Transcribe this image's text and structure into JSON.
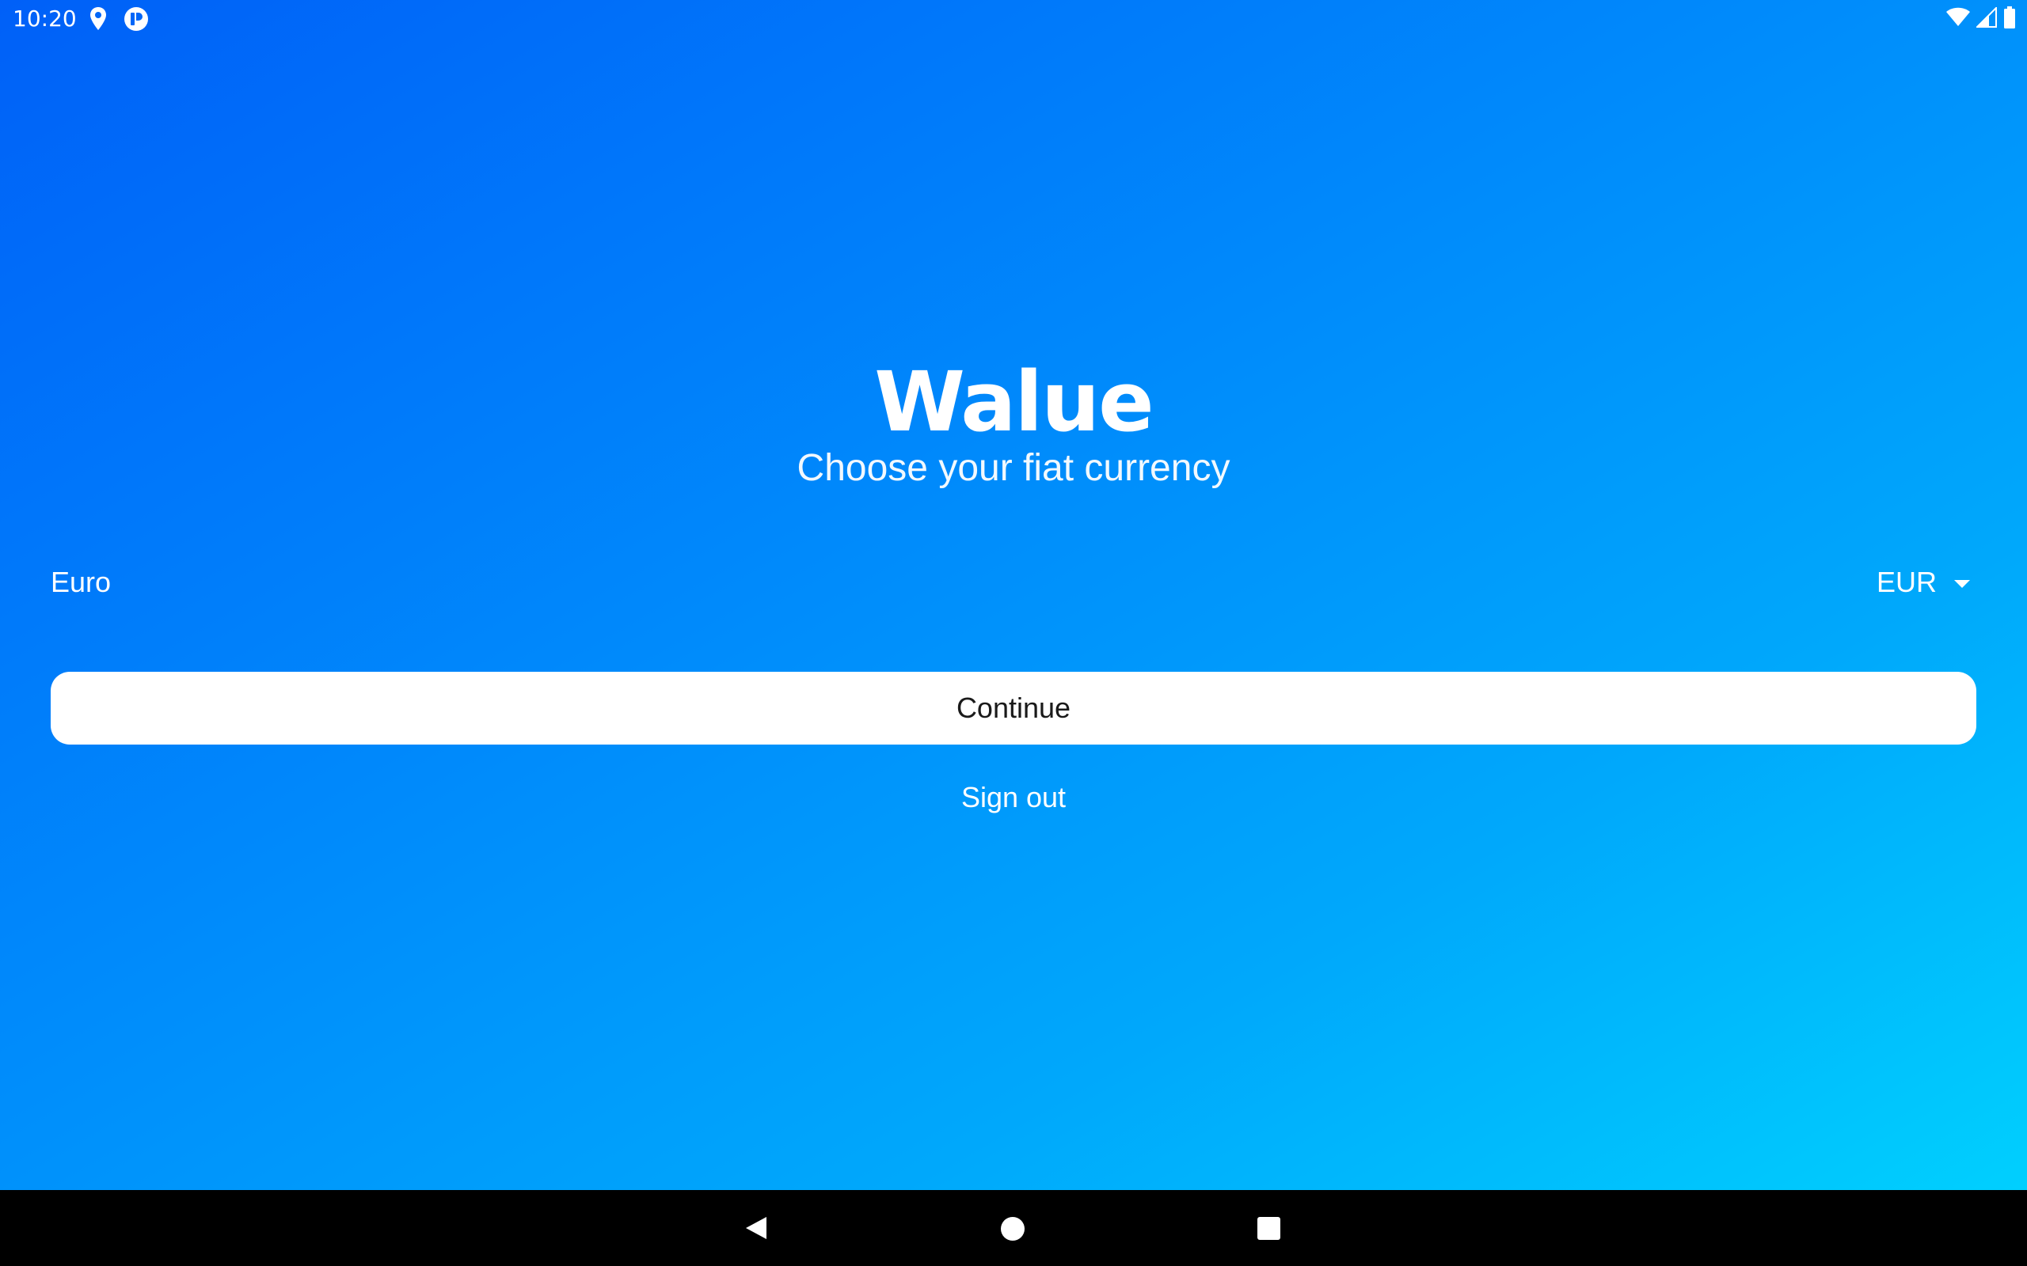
{
  "status_bar": {
    "time": "10:20",
    "left_icons": [
      "location-pin-icon",
      "app-notification-icon"
    ],
    "right_icons": [
      "wifi-icon",
      "cell-signal-icon",
      "battery-icon"
    ]
  },
  "app": {
    "name": "Walue",
    "subtitle": "Choose your fiat currency"
  },
  "currency": {
    "name": "Euro",
    "selected_code": "EUR"
  },
  "actions": {
    "continue_label": "Continue",
    "signout_label": "Sign out"
  },
  "nav_bar": {
    "buttons": [
      "back-icon",
      "home-icon",
      "recents-icon"
    ]
  },
  "colors": {
    "gradient_start": "#0060f8",
    "gradient_end": "#00d4fe",
    "button_bg": "#ffffff",
    "button_text": "#1a1a1a",
    "nav_bg": "#000000"
  }
}
